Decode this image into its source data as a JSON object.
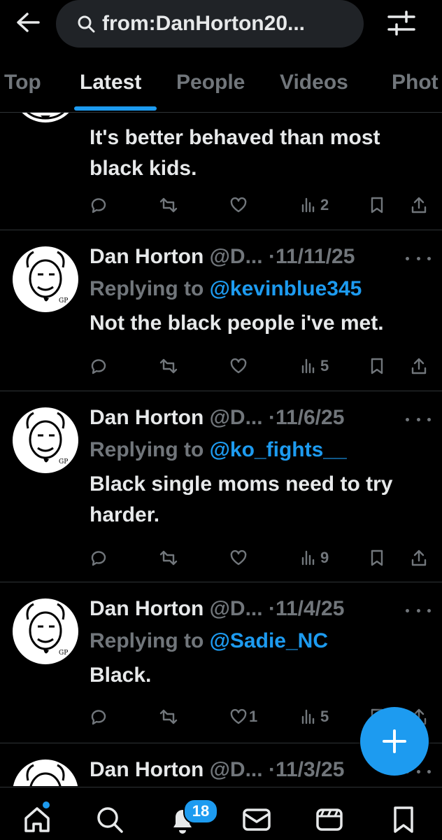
{
  "search": {
    "query": "from:DanHorton20..."
  },
  "tabs": [
    {
      "label": "Top"
    },
    {
      "label": "Latest"
    },
    {
      "label": "People"
    },
    {
      "label": "Videos"
    },
    {
      "label": "Phot"
    }
  ],
  "active_tab": "Latest",
  "tweets": [
    {
      "text": "It's better behaved than most black kids.",
      "actions": {
        "reply": "",
        "retweet": "",
        "like": "",
        "views": "2"
      }
    },
    {
      "name": "Dan Horton",
      "handle": "@D...",
      "dot": "·",
      "date": "11/11/25",
      "replying_prefix": "Replying to ",
      "replying_to": "@kevinblue345",
      "text": "Not the black people i've met.",
      "actions": {
        "reply": "",
        "retweet": "",
        "like": "",
        "views": "5"
      }
    },
    {
      "name": "Dan Horton",
      "handle": "@D...",
      "dot": "·",
      "date": "11/6/25",
      "replying_prefix": "Replying to ",
      "replying_to": "@ko_fights__",
      "text": "Black single moms need to try harder.",
      "actions": {
        "reply": "",
        "retweet": "",
        "like": "",
        "views": "9"
      }
    },
    {
      "name": "Dan Horton",
      "handle": "@D...",
      "dot": "·",
      "date": "11/4/25",
      "replying_prefix": "Replying to ",
      "replying_to": "@Sadie_NC",
      "text": "Black.",
      "actions": {
        "reply": "",
        "retweet": "",
        "like": "1",
        "views": "5"
      }
    },
    {
      "name": "Dan Horton",
      "handle": "@D...",
      "dot": "·",
      "date": "11/3/25"
    }
  ],
  "notifications_badge": "18",
  "colors": {
    "accent": "#1d9bf0",
    "background": "#000000",
    "muted": "#71767b",
    "text": "#e7e9ea",
    "divider": "#2f3336"
  },
  "icons": {
    "header": [
      "back-arrow-icon",
      "search-icon",
      "filter-sliders-icon"
    ],
    "actions": [
      "reply-icon",
      "retweet-icon",
      "like-icon",
      "views-icon",
      "bookmark-icon",
      "share-icon"
    ],
    "nav": [
      "home-icon",
      "explore-icon",
      "notifications-icon",
      "messages-icon",
      "grok-icon",
      "bookmarks-icon"
    ],
    "fab": "plus-icon"
  }
}
